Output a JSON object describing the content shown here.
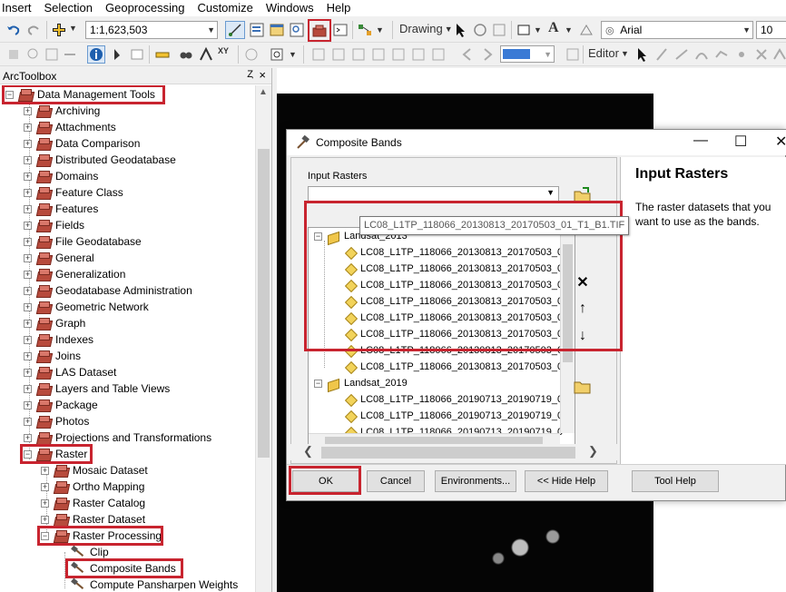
{
  "menu": [
    "Insert",
    "Selection",
    "Geoprocessing",
    "Customize",
    "Windows",
    "Help"
  ],
  "toolbar1": {
    "scale_value": "1:1,623,503",
    "drawing_label": "Drawing",
    "font_name": "Arial",
    "font_size": "10",
    "text_tool_label": "A"
  },
  "toolbar2": {
    "editor_label": "Editor"
  },
  "arctoolbox": {
    "title": "ArcToolbox",
    "pin_icon": "Ȥ",
    "close_icon": "×",
    "root": "Data Management Tools",
    "items": [
      "Archiving",
      "Attachments",
      "Data Comparison",
      "Distributed Geodatabase",
      "Domains",
      "Feature Class",
      "Features",
      "Fields",
      "File Geodatabase",
      "General",
      "Generalization",
      "Geodatabase Administration",
      "Geometric Network",
      "Graph",
      "Indexes",
      "Joins",
      "LAS Dataset",
      "Layers and Table Views",
      "Package",
      "Photos",
      "Projections and Transformations"
    ],
    "raster": "Raster",
    "raster_children": [
      "Mosaic Dataset",
      "Ortho Mapping",
      "Raster Catalog",
      "Raster Dataset"
    ],
    "raster_processing": "Raster Processing",
    "processing_tools": [
      "Clip",
      "Composite Bands",
      "Compute Pansharpen Weights"
    ]
  },
  "dialog": {
    "title": "Composite Bands",
    "minimize": "—",
    "maximize": "☐",
    "close": "✕",
    "input_label": "Input Rasters",
    "group1": "Landsat_2013",
    "tooltip": "LC08_L1TP_118066_20130813_20170503_01_T1_B1.TIF",
    "group1_items": [
      "LC08_L1TP_118066_20130813_20170503_0",
      "LC08_L1TP_118066_20130813_20170503_0",
      "LC08_L1TP_118066_20130813_20170503_0",
      "LC08_L1TP_118066_20130813_20170503_0",
      "LC08_L1TP_118066_20130813_20170503_0",
      "LC08_L1TP_118066_20130813_20170503_0",
      "LC08_L1TP_118066_20130813_20170503_0"
    ],
    "group2": "Landsat_2019",
    "group2_items": [
      "LC08_L1TP_118066_20190713_20190719_0",
      "LC08_L1TP_118066_20190713_20190719_0",
      "LC08_L1TP_118066_20190713_20190719_0"
    ],
    "side_buttons": {
      "remove": "✕",
      "up": "↑",
      "down": "↓"
    },
    "help_title": "Input Rasters",
    "help_text": "The raster datasets that you want to use as the bands.",
    "buttons": {
      "ok": "OK",
      "cancel": "Cancel",
      "environments": "Environments...",
      "hide_help": "<< Hide Help",
      "tool_help": "Tool Help"
    }
  },
  "colors": {
    "highlight_red": "#c8242f",
    "map_black": "#050505"
  }
}
